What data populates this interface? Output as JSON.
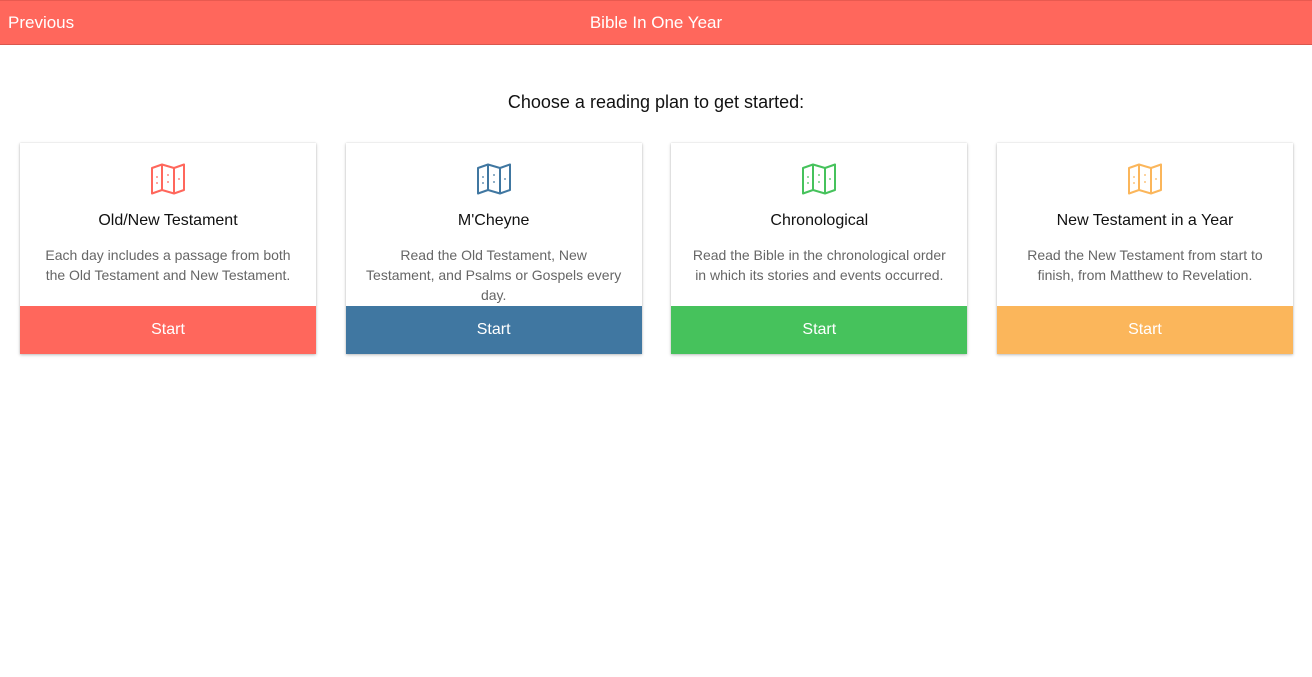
{
  "navbar": {
    "previous_label": "Previous",
    "title": "Bible In One Year",
    "color": "#ff675c"
  },
  "heading": "Choose a reading plan to get started:",
  "plans": [
    {
      "icon": "map-icon",
      "title": "Old/New Testament",
      "description": "Each day includes a passage from both the Old Testament and New Testament.",
      "button_label": "Start",
      "color": "#ff675c"
    },
    {
      "icon": "map-icon",
      "title": "M'Cheyne",
      "description": "Read the Old Testament, New Testament, and Psalms or Gospels every day.",
      "button_label": "Start",
      "color": "#4077a1"
    },
    {
      "icon": "map-icon",
      "title": "Chronological",
      "description": "Read the Bible in the chronological order in which its stories and events occurred.",
      "button_label": "Start",
      "color": "#46c25c"
    },
    {
      "icon": "map-icon",
      "title": "New Testament in a Year",
      "description": "Read the New Testament from start to finish, from Matthew to Revelation.",
      "button_label": "Start",
      "color": "#fbb65b"
    }
  ]
}
